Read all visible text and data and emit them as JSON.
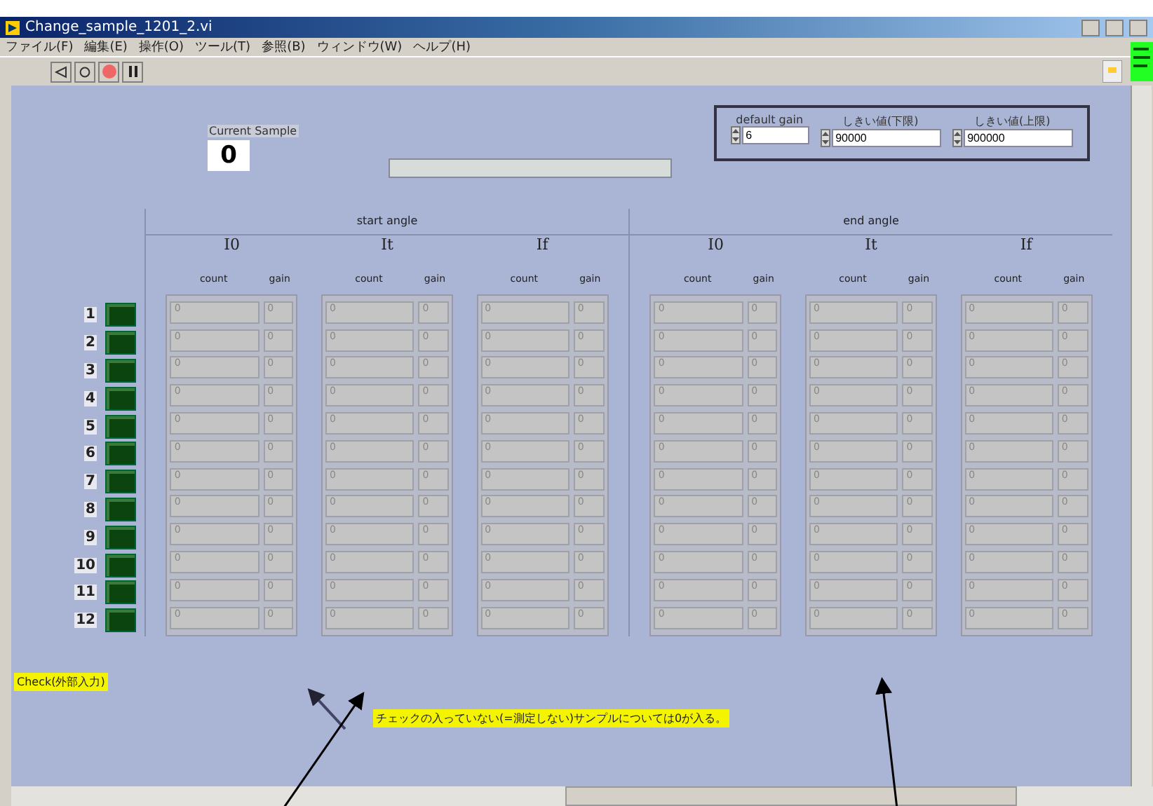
{
  "window": {
    "title": "Change_sample_1201_2.vi"
  },
  "menu": [
    "ファイル(F)",
    "編集(E)",
    "操作(O)",
    "ツール(T)",
    "参照(B)",
    "ウィンドウ(W)",
    "ヘルプ(H)"
  ],
  "current_sample": {
    "label": "Current Sample",
    "value": "0"
  },
  "settings": [
    {
      "label": "default gain",
      "value": "6"
    },
    {
      "label": "しきい値(下限)",
      "value": "90000"
    },
    {
      "label": "しきい値(上限)",
      "value": "900000"
    }
  ],
  "samples": [
    {
      "number": "1",
      "checked": false
    },
    {
      "number": "2",
      "checked": false
    },
    {
      "number": "3",
      "checked": false
    },
    {
      "number": "4",
      "checked": false
    },
    {
      "number": "5",
      "checked": false
    },
    {
      "number": "6",
      "checked": false
    },
    {
      "number": "7",
      "checked": false
    },
    {
      "number": "8",
      "checked": false
    },
    {
      "number": "9",
      "checked": false
    },
    {
      "number": "10",
      "checked": false
    },
    {
      "number": "11",
      "checked": false
    },
    {
      "number": "12",
      "checked": false
    }
  ],
  "groups": [
    {
      "title": "start angle",
      "channels": [
        {
          "name": "I0",
          "columns": [
            "count",
            "gain"
          ],
          "rows": [
            [
              "0",
              "0"
            ],
            [
              "0",
              "0"
            ],
            [
              "0",
              "0"
            ],
            [
              "0",
              "0"
            ],
            [
              "0",
              "0"
            ],
            [
              "0",
              "0"
            ],
            [
              "0",
              "0"
            ],
            [
              "0",
              "0"
            ],
            [
              "0",
              "0"
            ],
            [
              "0",
              "0"
            ],
            [
              "0",
              "0"
            ],
            [
              "0",
              "0"
            ]
          ]
        },
        {
          "name": "It",
          "columns": [
            "count",
            "gain"
          ],
          "rows": [
            [
              "0",
              "0"
            ],
            [
              "0",
              "0"
            ],
            [
              "0",
              "0"
            ],
            [
              "0",
              "0"
            ],
            [
              "0",
              "0"
            ],
            [
              "0",
              "0"
            ],
            [
              "0",
              "0"
            ],
            [
              "0",
              "0"
            ],
            [
              "0",
              "0"
            ],
            [
              "0",
              "0"
            ],
            [
              "0",
              "0"
            ],
            [
              "0",
              "0"
            ]
          ]
        },
        {
          "name": "If",
          "columns": [
            "count",
            "gain"
          ],
          "rows": [
            [
              "0",
              "0"
            ],
            [
              "0",
              "0"
            ],
            [
              "0",
              "0"
            ],
            [
              "0",
              "0"
            ],
            [
              "0",
              "0"
            ],
            [
              "0",
              "0"
            ],
            [
              "0",
              "0"
            ],
            [
              "0",
              "0"
            ],
            [
              "0",
              "0"
            ],
            [
              "0",
              "0"
            ],
            [
              "0",
              "0"
            ],
            [
              "0",
              "0"
            ]
          ]
        }
      ]
    },
    {
      "title": "end angle",
      "channels": [
        {
          "name": "I0",
          "columns": [
            "count",
            "gain"
          ],
          "rows": [
            [
              "0",
              "0"
            ],
            [
              "0",
              "0"
            ],
            [
              "0",
              "0"
            ],
            [
              "0",
              "0"
            ],
            [
              "0",
              "0"
            ],
            [
              "0",
              "0"
            ],
            [
              "0",
              "0"
            ],
            [
              "0",
              "0"
            ],
            [
              "0",
              "0"
            ],
            [
              "0",
              "0"
            ],
            [
              "0",
              "0"
            ],
            [
              "0",
              "0"
            ]
          ]
        },
        {
          "name": "It",
          "columns": [
            "count",
            "gain"
          ],
          "rows": [
            [
              "0",
              "0"
            ],
            [
              "0",
              "0"
            ],
            [
              "0",
              "0"
            ],
            [
              "0",
              "0"
            ],
            [
              "0",
              "0"
            ],
            [
              "0",
              "0"
            ],
            [
              "0",
              "0"
            ],
            [
              "0",
              "0"
            ],
            [
              "0",
              "0"
            ],
            [
              "0",
              "0"
            ],
            [
              "0",
              "0"
            ],
            [
              "0",
              "0"
            ]
          ]
        },
        {
          "name": "If",
          "columns": [
            "count",
            "gain"
          ],
          "rows": [
            [
              "0",
              "0"
            ],
            [
              "0",
              "0"
            ],
            [
              "0",
              "0"
            ],
            [
              "0",
              "0"
            ],
            [
              "0",
              "0"
            ],
            [
              "0",
              "0"
            ],
            [
              "0",
              "0"
            ],
            [
              "0",
              "0"
            ],
            [
              "0",
              "0"
            ],
            [
              "0",
              "0"
            ],
            [
              "0",
              "0"
            ],
            [
              "0",
              "0"
            ]
          ]
        }
      ]
    }
  ],
  "check_label": "Check(外部入力)",
  "note": "チェックの入っていない(=測定しない)サンプルについては0が入る。"
}
